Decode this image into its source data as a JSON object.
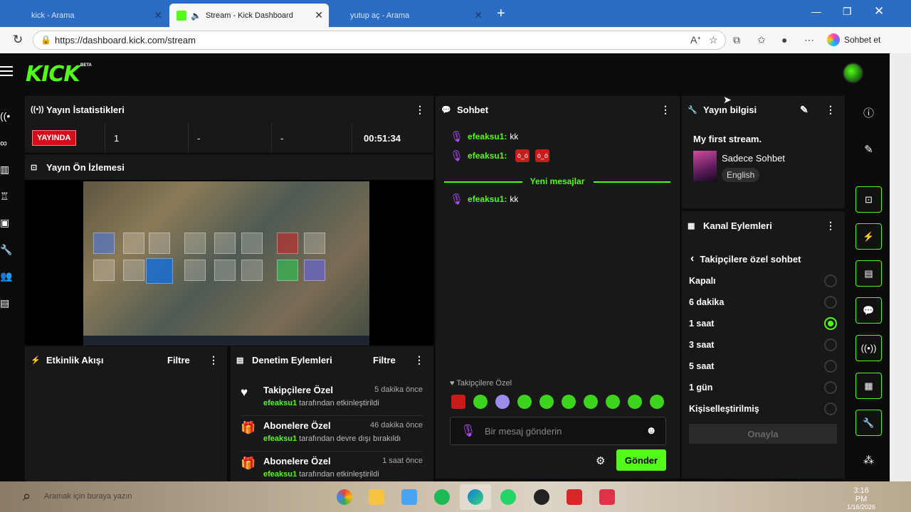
{
  "browser": {
    "tabs": [
      {
        "label": "kick - Arama"
      },
      {
        "label": "Stream - Kick Dashboard"
      },
      {
        "label": "yutup aç - Arama"
      }
    ],
    "url": "https://dashboard.kick.com/stream",
    "copilot_label": "Sohbet et"
  },
  "app": {
    "logo": "KICK",
    "beta": "BETA"
  },
  "stats_panel": {
    "title": "Yayın İstatistikleri",
    "live_badge": "YAYINDA",
    "viewers": "1",
    "stat2": "-",
    "stat3": "-",
    "duration": "00:51:34"
  },
  "preview_panel": {
    "title": "Yayın Ön İzlemesi"
  },
  "activity_panel": {
    "title": "Etkinlik Akışı",
    "filter": "Filtre"
  },
  "mod_panel": {
    "title": "Denetim Eylemleri",
    "filter": "Filtre",
    "rows": [
      {
        "title": "Takipçilere Özel",
        "when": "5 dakika önce",
        "user": "efeaksu1",
        "text": "tarafından etkinleştirildi"
      },
      {
        "title": "Abonelere Özel",
        "when": "46 dakika önce",
        "user": "efeaksu1",
        "text": "tarafından devre dışı bırakıldı"
      },
      {
        "title": "Abonelere Özel",
        "when": "1 saat önce",
        "user": "efeaksu1",
        "text": "tarafından etkinleştirildi"
      }
    ]
  },
  "chat_panel": {
    "title": "Sohbet",
    "messages": [
      {
        "user": "efeaksu1:",
        "text": "kk"
      },
      {
        "user": "efeaksu1:",
        "text": ""
      },
      {
        "user": "efeaksu1:",
        "text": "kk"
      }
    ],
    "new_messages": "Yeni mesajlar",
    "follower_only": "Takipçilere Özel",
    "input_placeholder": "Bir mesaj gönderin",
    "send": "Gönder"
  },
  "info_panel": {
    "title": "Yayın bilgisi",
    "stream_title": "My first stream.",
    "category": "Sadece Sohbet",
    "language": "English"
  },
  "channel_panel": {
    "title": "Kanal Eylemleri",
    "submenu": "Takipçilere özel sohbet",
    "options": [
      {
        "label": "Kapalı",
        "selected": false
      },
      {
        "label": "6 dakika",
        "selected": false
      },
      {
        "label": "1 saat",
        "selected": true
      },
      {
        "label": "3 saat",
        "selected": false
      },
      {
        "label": "5 saat",
        "selected": false
      },
      {
        "label": "1 gün",
        "selected": false
      },
      {
        "label": "Kişiselleştirilmiş",
        "selected": false
      }
    ],
    "approve": "Onayla"
  },
  "taskbar": {
    "search_text": "Aramak için buraya yazın",
    "time": "3:16 PM",
    "date": "1/16/2026"
  },
  "colors": {
    "brand": "#53fc18",
    "live": "#d40d1d",
    "panel": "#181818"
  }
}
